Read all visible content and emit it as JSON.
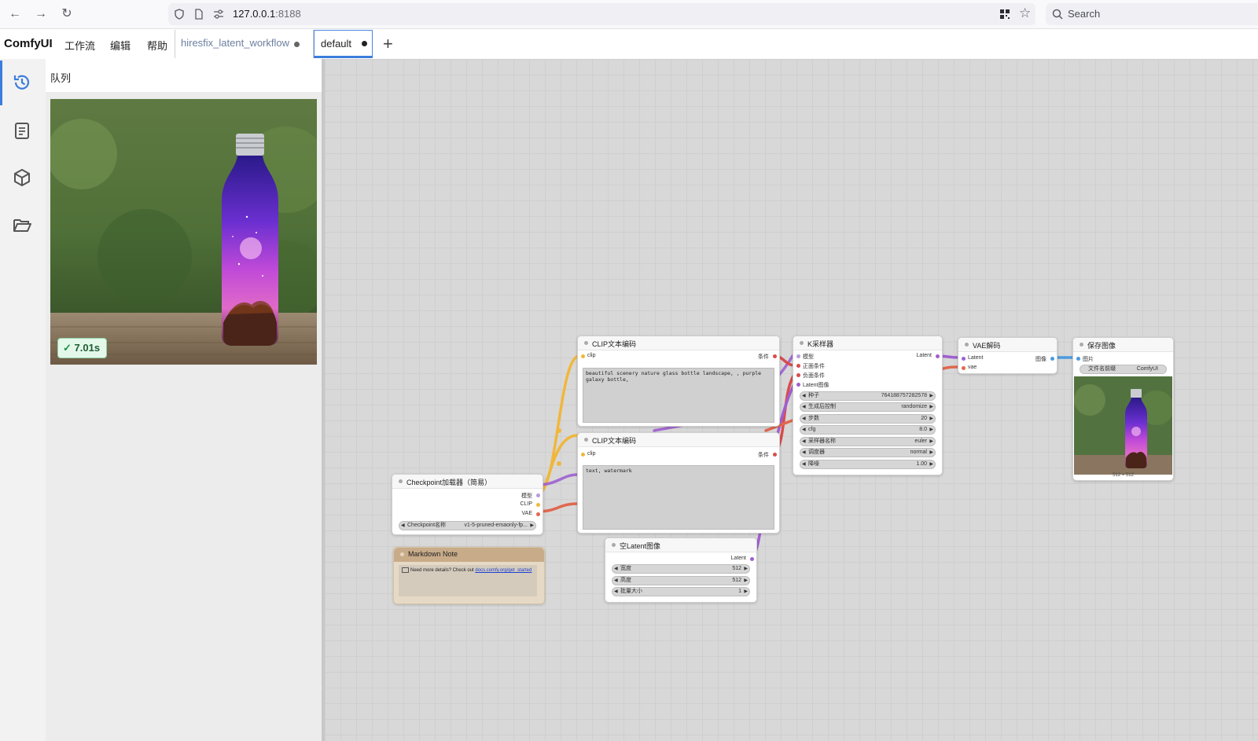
{
  "browser": {
    "url_host": "127.0.0.1",
    "url_port": ":8188",
    "search_placeholder": "Search"
  },
  "app": {
    "logo": "ComfyUI",
    "menu": [
      "工作流",
      "编辑",
      "帮助"
    ],
    "tabs": [
      {
        "label": "hiresfix_latent_workflow",
        "unsaved": true
      },
      {
        "label": "default",
        "unsaved": true,
        "active": true
      }
    ],
    "new_tab": "+"
  },
  "sidebar": {
    "items": [
      {
        "icon": "history-icon",
        "active": true
      },
      {
        "icon": "document-icon"
      },
      {
        "icon": "cube-icon"
      },
      {
        "icon": "folder-icon"
      }
    ]
  },
  "queue": {
    "title": "队列",
    "items": [
      {
        "image": "purple galaxy bottle on wooden table",
        "duration": "7.01s",
        "status": "success"
      }
    ]
  },
  "nodes": {
    "clip1": {
      "title": "CLIP文本编码",
      "input": "clip",
      "output": "条件",
      "text": "beautiful scenery nature glass bottle landscape, , purple galaxy bottle,"
    },
    "clip2": {
      "title": "CLIP文本编码",
      "input": "clip",
      "output": "条件",
      "text": "text, watermark"
    },
    "ksampler": {
      "title": "K采样器",
      "inputs": [
        "模型",
        "正面条件",
        "负面条件",
        "Latent图像"
      ],
      "output": "Latent",
      "widgets": [
        {
          "label": "种子",
          "value": "764188757282578"
        },
        {
          "label": "生成后控制",
          "value": "randomize"
        },
        {
          "label": "步数",
          "value": "20"
        },
        {
          "label": "cfg",
          "value": "8.0"
        },
        {
          "label": "采样器名称",
          "value": "euler"
        },
        {
          "label": "调度器",
          "value": "normal"
        },
        {
          "label": "降噪",
          "value": "1.00"
        }
      ]
    },
    "vae": {
      "title": "VAE解码",
      "inputs": [
        "Latent",
        "vae"
      ],
      "output": "图像"
    },
    "save": {
      "title": "保存图像",
      "input": "图片",
      "widget": {
        "label": "文件名前缀",
        "value": "ComfyUI"
      },
      "size": "512 × 512"
    },
    "checkpoint": {
      "title": "Checkpoint加载器（简易）",
      "outputs": [
        "模型",
        "CLIP",
        "VAE"
      ],
      "widget": {
        "label": "Checkpoint名称",
        "value": "v1-5-pruned-emaonly-fp..."
      }
    },
    "latent": {
      "title": "空Latent图像",
      "output": "Latent",
      "widgets": [
        {
          "label": "宽度",
          "value": "512"
        },
        {
          "label": "高度",
          "value": "512"
        },
        {
          "label": "批量大小",
          "value": "1"
        }
      ]
    },
    "markdown": {
      "title": "Markdown Note",
      "text": "Need more details? Check out ",
      "link": "docs.comfy.org/get_started"
    }
  },
  "colors": {
    "accent": "#3b7ddd",
    "model": "#b39ddb",
    "clip": "#f0b73c",
    "vae": "#e0684f",
    "conditioning": "#d94c4c",
    "latent": "#9f5fd0",
    "image": "#4a9be0"
  }
}
